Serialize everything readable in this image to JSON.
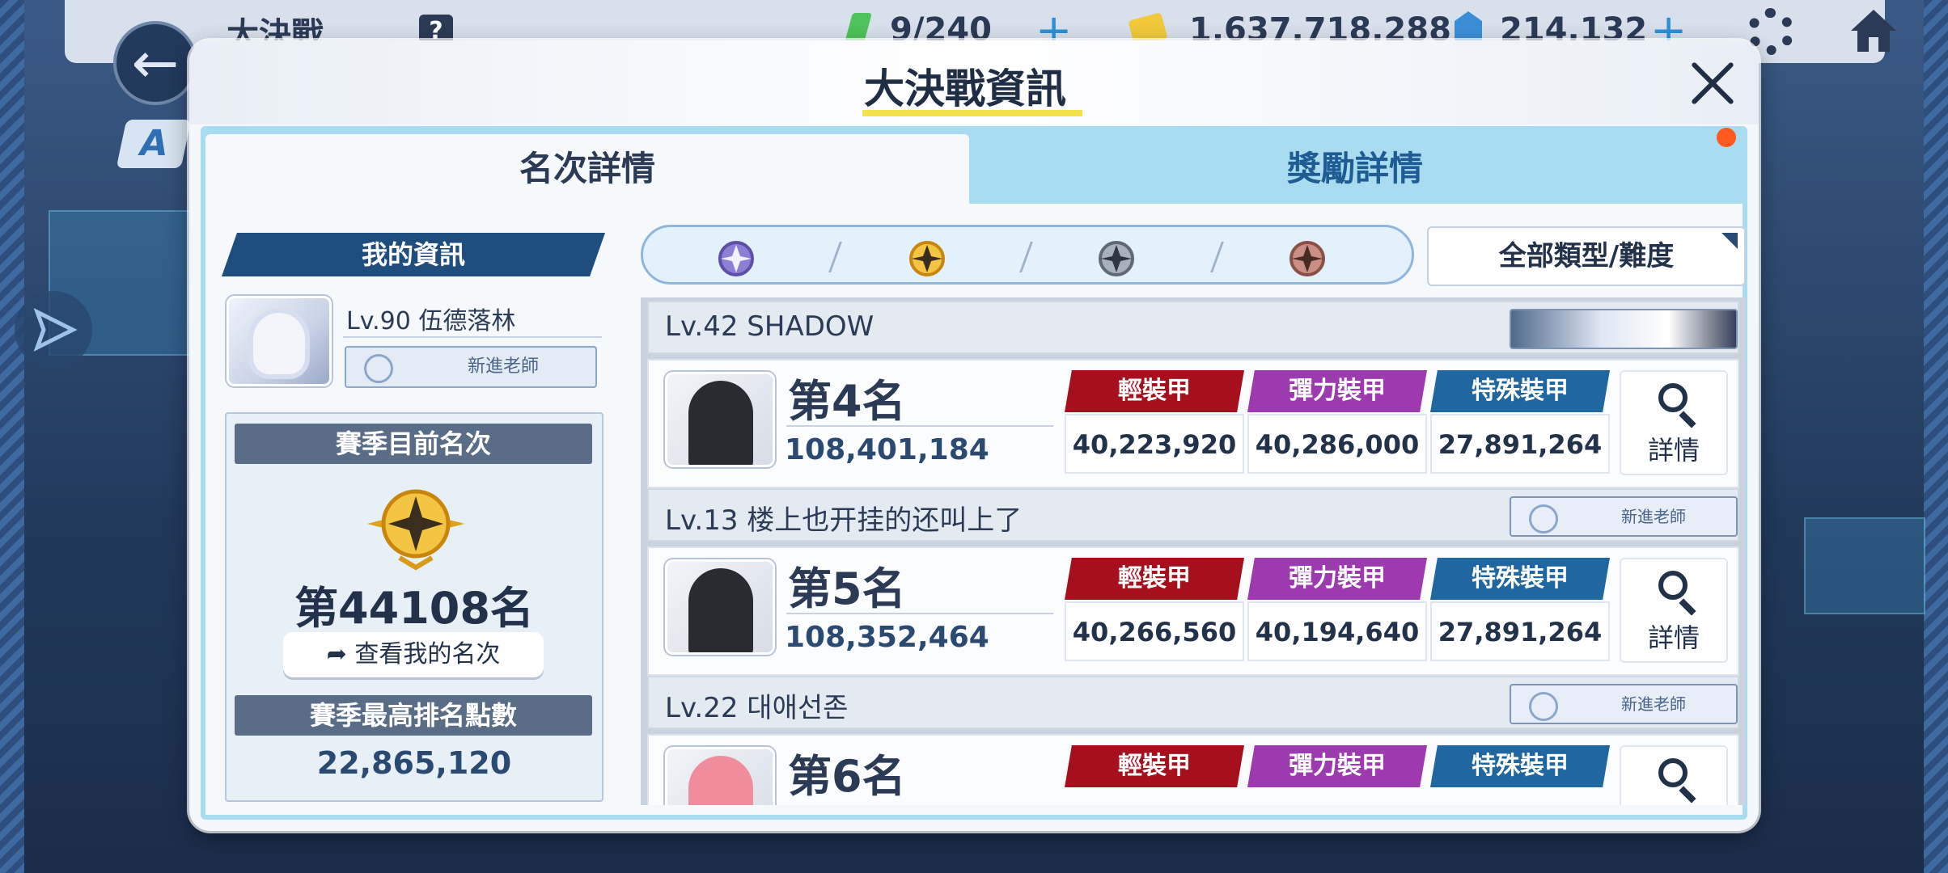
{
  "topbar": {
    "title": "大決戰",
    "help": "?",
    "ap": "9/240",
    "credits": "1,637,718,288",
    "gems": "214,132"
  },
  "modal": {
    "title": "大決戰資訊",
    "tabs": {
      "rank": "名次詳情",
      "reward": "獎勵詳情"
    }
  },
  "my_info": {
    "header": "我的資訊",
    "name": "Lv.90 伍德落林",
    "title_badge": "新進老師",
    "season_rank_header": "賽季目前名次",
    "season_rank": "第44108名",
    "check_rank_button": "查看我的名次",
    "highest_points_header": "賽季最高排名點數",
    "highest_points": "22,865,120"
  },
  "filter": {
    "select": "全部類型/難度"
  },
  "armor_labels": {
    "light": "輕裝甲",
    "elastic": "彈力裝甲",
    "special": "特殊裝甲"
  },
  "detail_label": "詳情",
  "entries": [
    {
      "player": "Lv.42  SHADOW",
      "title": "",
      "rank": "第4名",
      "score": "108,401,184",
      "light": "40,223,920",
      "elastic": "40,286,000",
      "special": "27,891,264"
    },
    {
      "player": "Lv.13  楼上也开挂的还叫上了",
      "title": "新進老師",
      "rank": "第5名",
      "score": "108,352,464",
      "light": "40,266,560",
      "elastic": "40,194,640",
      "special": "27,891,264"
    },
    {
      "player": "Lv.22  대애선존",
      "title": "新進老師",
      "rank": "第6名",
      "score": "",
      "light": "",
      "elastic": "",
      "special": ""
    }
  ],
  "colors": {
    "light_armor": "#a5101c",
    "elastic_armor": "#9d3ab0",
    "special_armor": "#2066a0",
    "tab_bar": "#a9dcf1",
    "title_underline": "#f4e24c"
  }
}
